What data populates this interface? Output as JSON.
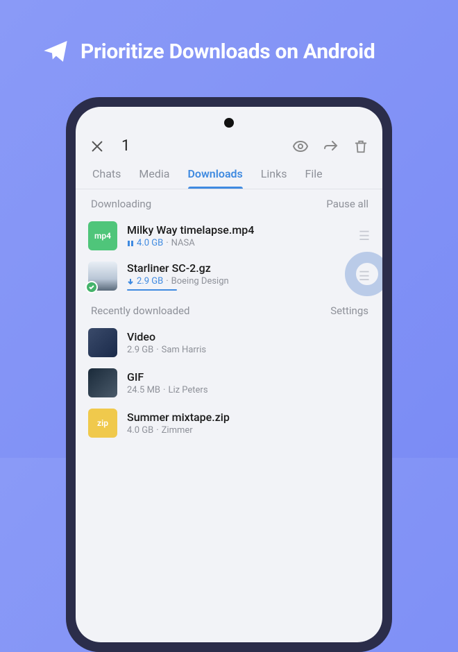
{
  "hero": {
    "title": "Prioritize Downloads on Android"
  },
  "appbar": {
    "selected_count": "1"
  },
  "tabs": [
    {
      "label": "Chats",
      "active": false
    },
    {
      "label": "Media",
      "active": false
    },
    {
      "label": "Downloads",
      "active": true
    },
    {
      "label": "Links",
      "active": false
    },
    {
      "label": "File",
      "active": false
    }
  ],
  "sections": {
    "downloading": {
      "title": "Downloading",
      "action": "Pause all",
      "items": [
        {
          "title": "Milky Way timelapse.mp4",
          "size": "4.0 GB",
          "source": "NASA",
          "thumb": "mp4",
          "thumb_label": "mp4",
          "status": "paused"
        },
        {
          "title": "Starliner SC-2.gz",
          "size": "2.9 GB",
          "source": "Boeing Design",
          "thumb": "img2",
          "status": "downloading",
          "selected": true
        }
      ]
    },
    "recent": {
      "title": "Recently downloaded",
      "action": "Settings",
      "items": [
        {
          "title": "Video",
          "size": "2.9 GB",
          "source": "Sam Harris",
          "thumb": "img1"
        },
        {
          "title": "GIF",
          "size": "24.5 MB",
          "source": "Liz Peters",
          "thumb": "img3"
        },
        {
          "title": "Summer mixtape.zip",
          "size": "4.0 GB",
          "source": "Zimmer",
          "thumb": "zip",
          "thumb_label": "zip"
        }
      ]
    }
  }
}
